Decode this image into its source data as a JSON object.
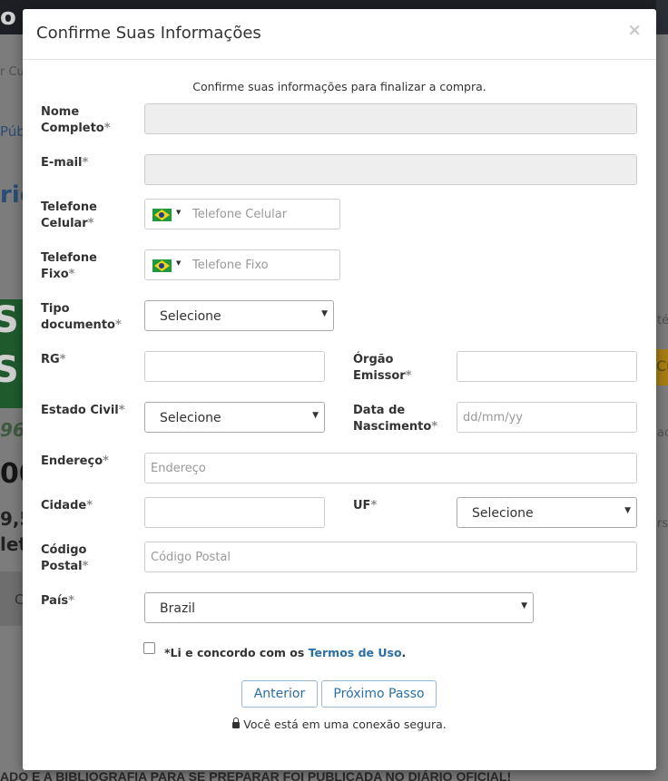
{
  "modal": {
    "title": "Confirme Suas Informações",
    "close_label": "×",
    "intro": "Confirme suas informações para finalizar a compra."
  },
  "form": {
    "required_marker": "*",
    "nome": {
      "label_line1": "Nome",
      "label_line2": "Completo",
      "value": ""
    },
    "email": {
      "label": "E-mail",
      "value": ""
    },
    "telefone_celular": {
      "label_line1": "Telefone",
      "label_line2": "Celular",
      "placeholder": "Telefone Celular",
      "country_icon": "brazil-flag-icon"
    },
    "telefone_fixo": {
      "label_line1": "Telefone",
      "label_line2": "Fixo",
      "placeholder": "Telefone Fixo",
      "country_icon": "brazil-flag-icon"
    },
    "tipo_documento": {
      "label_line1": "Tipo",
      "label_line2": "documento",
      "selected": "Selecione"
    },
    "rg": {
      "label": "RG",
      "value": ""
    },
    "orgao_emissor": {
      "label_line1": "Órgão",
      "label_line2": "Emissor",
      "value": ""
    },
    "estado_civil": {
      "label": "Estado Civil",
      "selected": "Selecione"
    },
    "data_nascimento": {
      "label_line1": "Data de",
      "label_line2": "Nascimento",
      "placeholder": "dd/mm/yy"
    },
    "endereco": {
      "label": "Endereço",
      "placeholder": "Endereço"
    },
    "cidade": {
      "label": "Cidade",
      "value": ""
    },
    "uf": {
      "label": "UF",
      "selected": "Selecione"
    },
    "codigo_postal": {
      "label_line1": "Código",
      "label_line2": "Postal",
      "placeholder": "Código Postal"
    },
    "pais": {
      "label": "País",
      "selected": "Brazil"
    },
    "terms": {
      "prefix": "*Li e concordo com os ",
      "link": "Termos de Uso",
      "suffix": ".",
      "checked": false
    }
  },
  "buttons": {
    "previous": "Anterior",
    "next": "Próximo Passo"
  },
  "secure_note": "Você está em uma conexão segura.",
  "background": {
    "logo_fragment": "o",
    "frag_1": "r Cu",
    "frag_2": "Púb",
    "frag_3": "ric",
    "frag_4": "96",
    "frag_5": "00",
    "frag_6": "9,5",
    "frag_7": "let",
    "frag_8": "C",
    "frag_right_1": "té",
    "frag_right_2": "ad",
    "frag_right_3": "rs",
    "frag_yellow": "Cu",
    "bottom_text": "ADO E A BIBLIOGRAFIA PARA SE PREPARAR FOI PUBLICADA NO DIÁRIO OFICIAL!"
  }
}
